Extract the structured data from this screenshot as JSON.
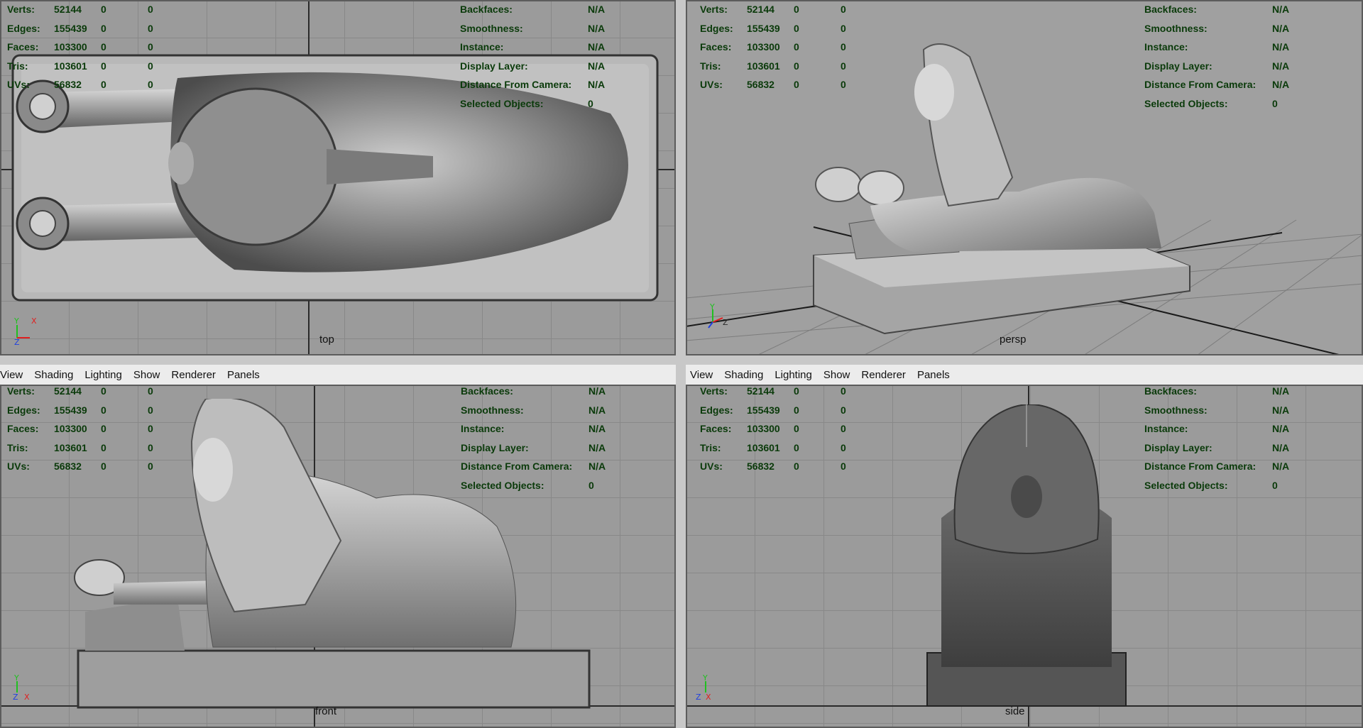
{
  "stats": {
    "left_rows": [
      {
        "label": "Verts:",
        "v1": "52144",
        "v2": "0",
        "v3": "0"
      },
      {
        "label": "Edges:",
        "v1": "155439",
        "v2": "0",
        "v3": "0"
      },
      {
        "label": "Faces:",
        "v1": "103300",
        "v2": "0",
        "v3": "0"
      },
      {
        "label": "Tris:",
        "v1": "103601",
        "v2": "0",
        "v3": "0"
      },
      {
        "label": "UVs:",
        "v1": "56832",
        "v2": "0",
        "v3": "0"
      }
    ],
    "right_rows": [
      {
        "label": "Backfaces:",
        "v1": "N/A"
      },
      {
        "label": "Smoothness:",
        "v1": "N/A"
      },
      {
        "label": "Instance:",
        "v1": "N/A"
      },
      {
        "label": "Display Layer:",
        "v1": "N/A"
      },
      {
        "label": "Distance From Camera:",
        "v1": "N/A"
      },
      {
        "label": "Selected Objects:",
        "v1": "0"
      }
    ]
  },
  "panels": {
    "top": {
      "camera": "top"
    },
    "persp": {
      "camera": "persp"
    },
    "front": {
      "camera": "front"
    },
    "side": {
      "camera": "side"
    }
  },
  "menu": {
    "items": [
      "View",
      "Shading",
      "Lighting",
      "Show",
      "Renderer",
      "Panels"
    ]
  },
  "axes": {
    "x": "X",
    "y": "Y",
    "z": "Z",
    "x_color": "#e02020",
    "y_color": "#20c020",
    "z_color": "#2040e0"
  }
}
